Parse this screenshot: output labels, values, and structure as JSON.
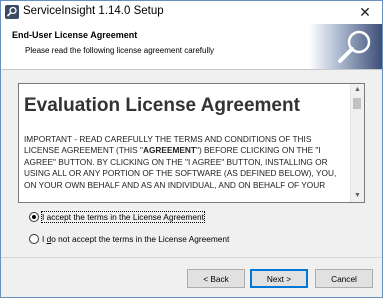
{
  "window": {
    "title": "ServiceInsight 1.14.0 Setup",
    "close_glyph": "✕",
    "icon": "app-icon"
  },
  "header": {
    "title": "End-User License Agreement",
    "subtitle": "Please read the following license agreement carefully",
    "banner_icon": "magnifier-icon"
  },
  "license": {
    "heading": "Evaluation License Agreement",
    "lines": [
      "IMPORTANT - READ CAREFULLY THE TERMS AND CONDITIONS OF THIS",
      "LICENSE AGREEMENT (THIS \"",
      "AGREEMENT",
      "\") BEFORE CLICKING ON THE \"I",
      "AGREE\" BUTTON. BY CLICKING ON THE \"I AGREE\" BUTTON, INSTALLING OR",
      "USING ALL OR ANY PORTION OF THE SOFTWARE (AS DEFINED BELOW), YOU,",
      "ON YOUR OWN BEHALF AND AS AN INDIVIDUAL, AND ON BEHALF OF YOUR"
    ],
    "scroll_up": "▲",
    "scroll_down": "▼"
  },
  "options": {
    "accept": "I accept the terms in the License Agreement",
    "decline_prefix": "I ",
    "decline_mnemonic": "d",
    "decline_rest": "o not accept the terms in the License Agreement",
    "selected": "accept"
  },
  "buttons": {
    "back": "< Back",
    "next": "Next >",
    "cancel": "Cancel"
  },
  "colors": {
    "accent": "#0078d7"
  }
}
